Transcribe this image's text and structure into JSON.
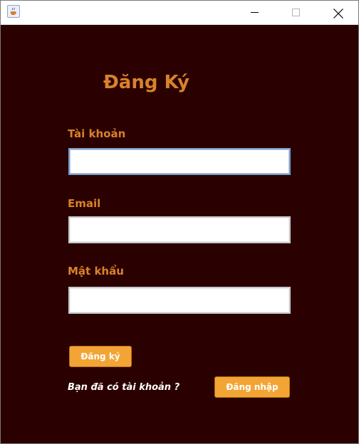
{
  "window": {
    "title": "",
    "icon": "java-cup-icon",
    "controls": [
      "minimize-icon",
      "maximize-icon",
      "close-icon"
    ]
  },
  "form": {
    "title": "Đăng Ký",
    "username_label": "Tài khoản",
    "username_value": "",
    "email_label": "Email",
    "email_value": "",
    "password_label": "Mật khẩu",
    "password_value": "",
    "register_button": "Đăng ký",
    "have_account_text": "Bạn đã có tài khoản ?",
    "login_button": "Đăng nhập"
  },
  "colors": {
    "background": "#2a0000",
    "accent": "#d9822b",
    "button": "#f2a535",
    "button_text": "#ffffff"
  }
}
